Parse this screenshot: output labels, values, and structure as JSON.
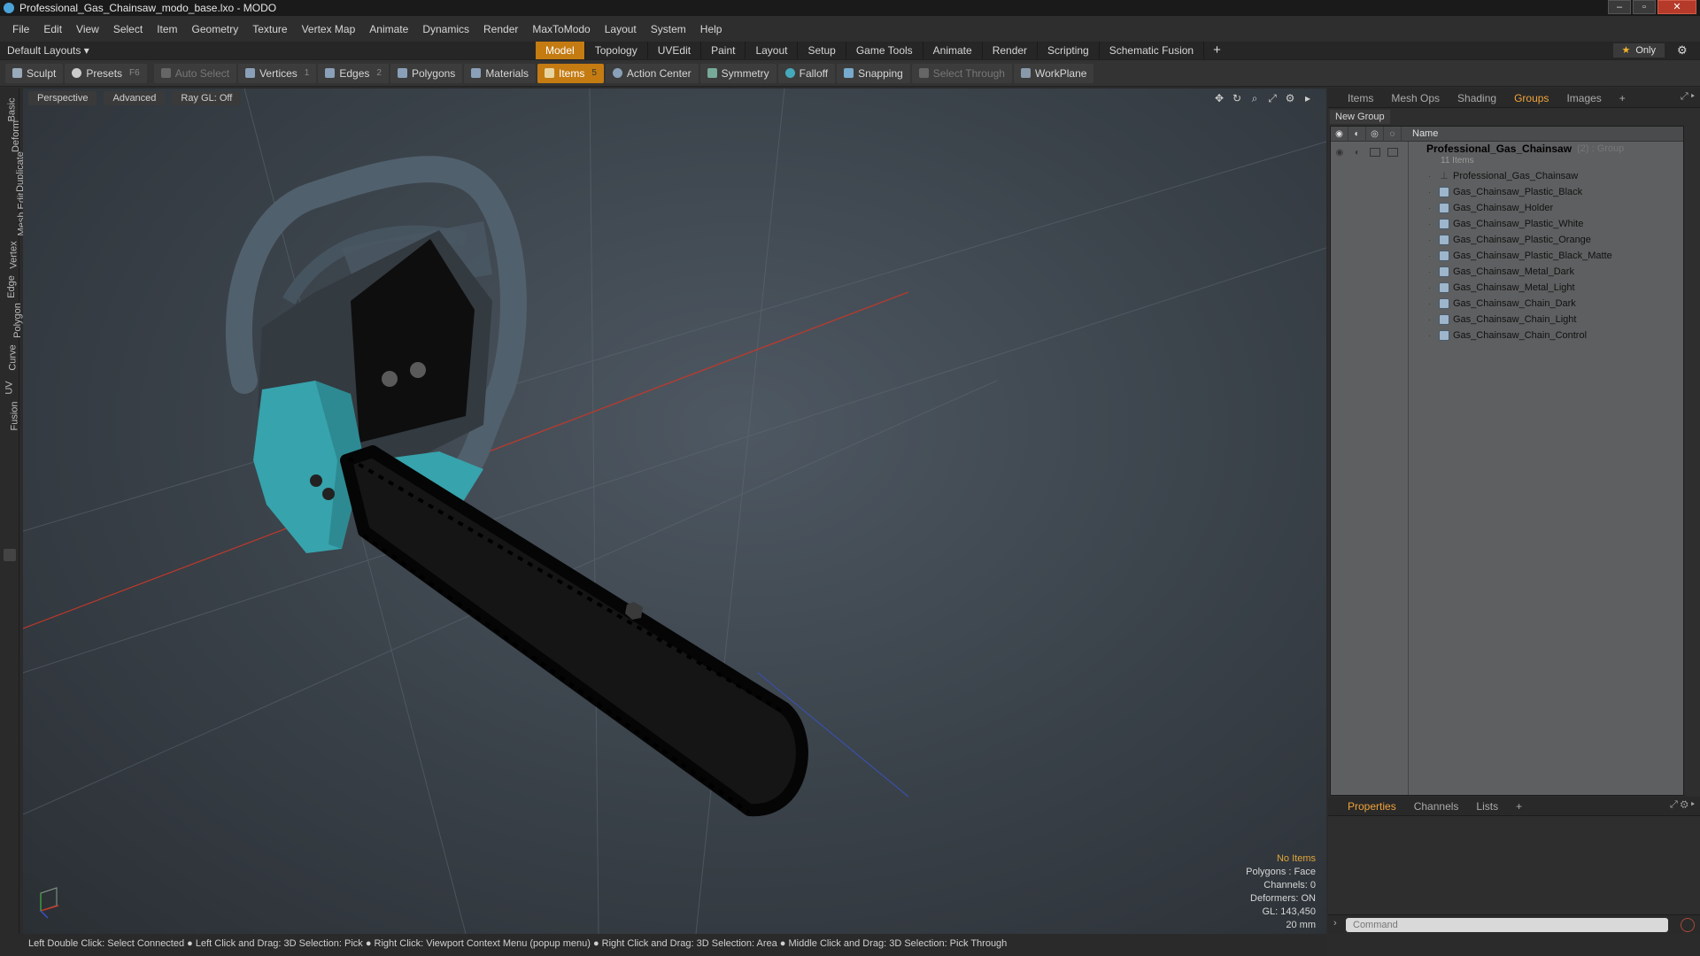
{
  "window": {
    "title": "Professional_Gas_Chainsaw_modo_base.lxo - MODO",
    "minimize": "–",
    "maximize": "▫",
    "close": "✕"
  },
  "menubar": [
    "File",
    "Edit",
    "View",
    "Select",
    "Item",
    "Geometry",
    "Texture",
    "Vertex Map",
    "Animate",
    "Dynamics",
    "Render",
    "MaxToModo",
    "Layout",
    "System",
    "Help"
  ],
  "layoutbar": {
    "default_layouts": "Default Layouts ▾",
    "tabs": [
      "Model",
      "Topology",
      "UVEdit",
      "Paint",
      "Layout",
      "Setup",
      "Game Tools",
      "Animate",
      "Render",
      "Scripting",
      "Schematic Fusion"
    ],
    "active_tab": "Model",
    "plus": "+",
    "only": "Only",
    "only_star": "★",
    "gear": "⚙"
  },
  "toolbar": {
    "sculpt": "Sculpt",
    "presets": "Presets",
    "presets_key": "F6",
    "auto_select": "Auto Select",
    "vertices": "Vertices",
    "vertices_count": "1",
    "edges": "Edges",
    "edges_count": "2",
    "polygons": "Polygons",
    "materials": "Materials",
    "items": "Items",
    "items_count": "5",
    "action_center": "Action Center",
    "symmetry": "Symmetry",
    "falloff": "Falloff",
    "snapping": "Snapping",
    "select_through": "Select Through",
    "workplane": "WorkPlane"
  },
  "left_tabs": [
    "Basic",
    "Deform",
    "Duplicate",
    "Mesh Edit",
    "Vertex",
    "Edge",
    "Polygon",
    "Curve",
    "UV",
    "Fusion"
  ],
  "viewport": {
    "perspective": "Perspective",
    "advanced": "Advanced",
    "raygl": "Ray GL: Off",
    "icons": [
      "✥",
      "↻",
      "⌕",
      "⤢",
      "⚙",
      "▸"
    ],
    "hud": {
      "title": "No Items",
      "polygons": "Polygons : Face",
      "channels": "Channels: 0",
      "deformers": "Deformers: ON",
      "gl": "GL: 143,450",
      "scale": "20 mm"
    }
  },
  "panel_tabs": [
    "Items",
    "Mesh Ops",
    "Shading",
    "Groups",
    "Images"
  ],
  "panel_active": "Groups",
  "groups": {
    "new_group": "New Group",
    "name_header": "Name",
    "group_name": "Professional_Gas_Chainsaw",
    "group_suffix": "(2) : Group",
    "group_count": "11 Items",
    "items": [
      {
        "label": "Professional_Gas_Chainsaw",
        "kind": "locator"
      },
      {
        "label": "Gas_Chainsaw_Plastic_Black",
        "kind": "mesh"
      },
      {
        "label": "Gas_Chainsaw_Holder",
        "kind": "mesh"
      },
      {
        "label": "Gas_Chainsaw_Plastic_White",
        "kind": "mesh"
      },
      {
        "label": "Gas_Chainsaw_Plastic_Orange",
        "kind": "mesh"
      },
      {
        "label": "Gas_Chainsaw_Plastic_Black_Matte",
        "kind": "mesh"
      },
      {
        "label": "Gas_Chainsaw_Metal_Dark",
        "kind": "mesh"
      },
      {
        "label": "Gas_Chainsaw_Metal_Light",
        "kind": "mesh"
      },
      {
        "label": "Gas_Chainsaw_Chain_Dark",
        "kind": "mesh"
      },
      {
        "label": "Gas_Chainsaw_Chain_Light",
        "kind": "mesh"
      },
      {
        "label": "Gas_Chainsaw_Chain_Control",
        "kind": "mesh"
      }
    ]
  },
  "props_tabs": [
    "Properties",
    "Channels",
    "Lists"
  ],
  "props_active": "Properties",
  "command_placeholder": "Command",
  "statusbar": "Left Double Click: Select Connected ● Left Click and Drag: 3D Selection: Pick ● Right Click: Viewport Context Menu (popup menu) ● Right Click and Drag: 3D Selection: Area ● Middle Click and Drag: 3D Selection: Pick Through",
  "colors": {
    "accent": "#c47b12",
    "active_tab_text": "#f0a33a",
    "chainsaw_body": "#3aa0a8",
    "chainsaw_handle": "#4a5a68",
    "bar": "#1a1a1a"
  }
}
